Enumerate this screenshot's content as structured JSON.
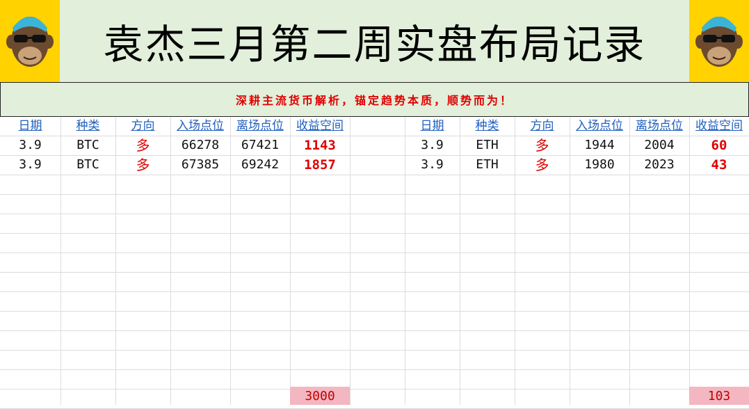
{
  "header": {
    "title": "袁杰三月第二周实盘布局记录",
    "subtitle": "深耕主流货币解析，锚定趋势本质，顺势而为！",
    "logo_icon": "monkey-sunglasses-icon"
  },
  "columns": [
    "日期",
    "种类",
    "方向",
    "入场点位",
    "离场点位",
    "收益空间"
  ],
  "btc_rows": [
    {
      "date": "3.9",
      "type": "BTC",
      "direction": "多",
      "entry": "66278",
      "exit": "67421",
      "profit": "1143"
    },
    {
      "date": "3.9",
      "type": "BTC",
      "direction": "多",
      "entry": "67385",
      "exit": "69242",
      "profit": "1857"
    }
  ],
  "eth_rows": [
    {
      "date": "3.9",
      "type": "ETH",
      "direction": "多",
      "entry": "1944",
      "exit": "2004",
      "profit": "60"
    },
    {
      "date": "3.9",
      "type": "ETH",
      "direction": "多",
      "entry": "1980",
      "exit": "2023",
      "profit": "43"
    }
  ],
  "totals": {
    "btc": "3000",
    "eth": "103"
  },
  "colors": {
    "banner_bg": "#e2efda",
    "logo_bg": "#ffd200",
    "header_blue": "#1f5fbf",
    "accent_red": "#e00000",
    "total_bg": "#f4b6c0"
  }
}
